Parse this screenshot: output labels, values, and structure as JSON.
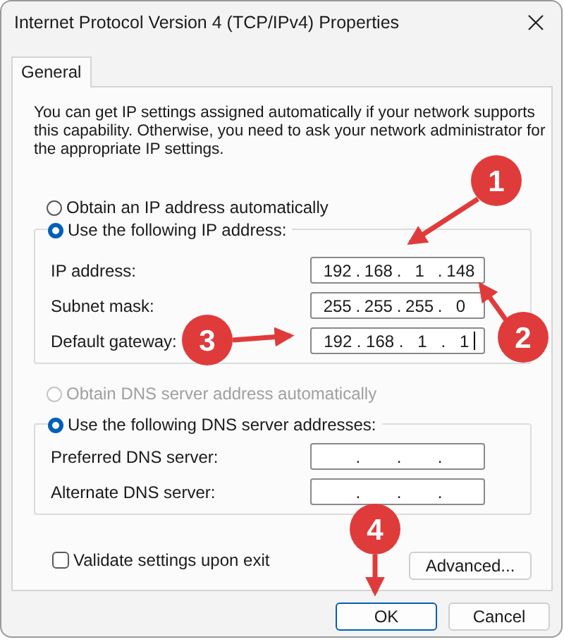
{
  "window": {
    "title": "Internet Protocol Version 4 (TCP/IPv4) Properties"
  },
  "tabs": [
    {
      "label": "General",
      "selected": true
    }
  ],
  "description": "You can get IP settings assigned automatically if your network supports this capability. Otherwise, you need to ask your network administrator for the appropriate IP settings.",
  "ip_settings": {
    "options": [
      {
        "label": "Obtain an IP address automatically",
        "selected": false,
        "disabled": false
      },
      {
        "label": "Use the following IP address:",
        "selected": true,
        "disabled": false
      }
    ],
    "fields": [
      {
        "label": "IP address:",
        "separator": ".",
        "octets": [
          "192",
          "168",
          "1",
          "148"
        ],
        "caret": false
      },
      {
        "label": "Subnet mask:",
        "separator": ".",
        "octets": [
          "255",
          "255",
          "255",
          "0"
        ],
        "caret": false
      },
      {
        "label": "Default gateway:",
        "separator": ".",
        "octets": [
          "192",
          "168",
          "1",
          "1"
        ],
        "caret": true
      }
    ]
  },
  "dns_settings": {
    "options": [
      {
        "label": "Obtain DNS server address automatically",
        "selected": false,
        "disabled": true
      },
      {
        "label": "Use the following DNS server addresses:",
        "selected": true,
        "disabled": false
      }
    ],
    "fields": [
      {
        "label": "Preferred DNS server:",
        "separator": ".",
        "caret": false
      },
      {
        "label": "Alternate DNS server:",
        "separator": ".",
        "caret": false
      }
    ]
  },
  "validate": {
    "label": "Validate settings upon exit",
    "checked": false
  },
  "buttons": [
    {
      "label": "Advanced...",
      "kind": "advanced"
    },
    {
      "label": "OK",
      "kind": "default"
    },
    {
      "label": "Cancel",
      "kind": "normal"
    }
  ],
  "callouts": [
    {
      "number": "1"
    },
    {
      "number": "2"
    },
    {
      "number": "3"
    },
    {
      "number": "4"
    }
  ]
}
